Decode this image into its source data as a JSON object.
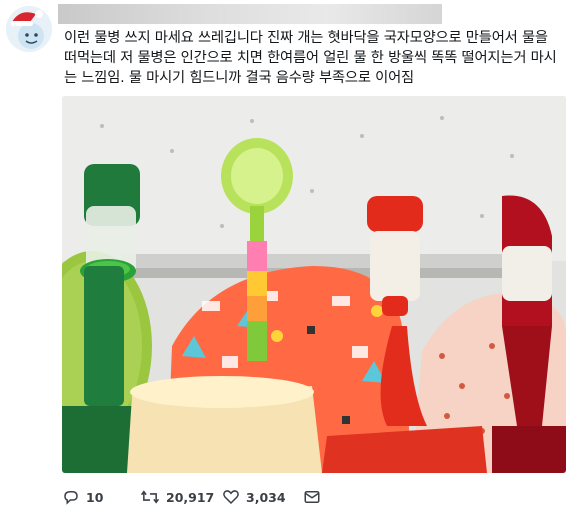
{
  "tweet": {
    "text": "이런 물병 쓰지 마세요 쓰레깁니다 진짜 개는 혓바닥을 국자모양으로 만들어서 물을 떠먹는데 저 물병은 인간으로 치면 한여름어 얼린 물 한 방울씩 똑똑 떨어지는거 마시는 느낌임. 물 마시기 힘드니까 결국 음수량 부족으로 이어짐"
  },
  "actions": {
    "replies": "10",
    "retweets": "20,917",
    "likes": "3,034"
  },
  "icons": {
    "reply": "reply-icon",
    "retweet": "retweet-icon",
    "like": "heart-icon",
    "message": "mail-icon"
  },
  "colors": {
    "text": "#14171a",
    "action": "#3b4046"
  }
}
